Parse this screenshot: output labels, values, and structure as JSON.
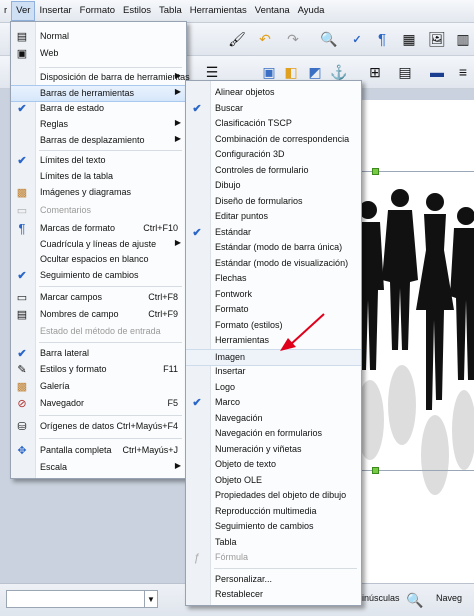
{
  "menubar": {
    "items": [
      {
        "label": "r"
      },
      {
        "label": "Ver"
      },
      {
        "label": "Insertar"
      },
      {
        "label": "Formato"
      },
      {
        "label": "Estilos"
      },
      {
        "label": "Tabla"
      },
      {
        "label": "Herramientas"
      },
      {
        "label": "Ventana"
      },
      {
        "label": "Ayuda"
      }
    ]
  },
  "view_menu": {
    "items": [
      {
        "label": "Normal"
      },
      {
        "label": "Web"
      },
      {
        "label": "Disposición de barra de herramientas"
      },
      {
        "label": "Barras de herramientas"
      },
      {
        "label": "Barra de estado"
      },
      {
        "label": "Reglas"
      },
      {
        "label": "Barras de desplazamiento"
      },
      {
        "label": "Límites del texto"
      },
      {
        "label": "Límites de la tabla"
      },
      {
        "label": "Imágenes y diagramas"
      },
      {
        "label": "Comentarios"
      },
      {
        "label": "Marcas de formato",
        "shortcut": "Ctrl+F10"
      },
      {
        "label": "Cuadrícula y líneas de ajuste"
      },
      {
        "label": "Ocultar espacios en blanco"
      },
      {
        "label": "Seguimiento de cambios"
      },
      {
        "label": "Marcar campos",
        "shortcut": "Ctrl+F8"
      },
      {
        "label": "Nombres de campo",
        "shortcut": "Ctrl+F9"
      },
      {
        "label": "Estado del método de entrada"
      },
      {
        "label": "Barra lateral"
      },
      {
        "label": "Estilos y formato",
        "shortcut": "F11"
      },
      {
        "label": "Galería"
      },
      {
        "label": "Navegador",
        "shortcut": "F5"
      },
      {
        "label": "Orígenes de datos",
        "shortcut": "Ctrl+Mayús+F4"
      },
      {
        "label": "Pantalla completa",
        "shortcut": "Ctrl+Mayús+J"
      },
      {
        "label": "Escala"
      }
    ]
  },
  "toolbars_menu": {
    "items": [
      {
        "label": "Alinear objetos"
      },
      {
        "label": "Buscar"
      },
      {
        "label": "Clasificación TSCP"
      },
      {
        "label": "Combinación de correspondencia"
      },
      {
        "label": "Configuración 3D"
      },
      {
        "label": "Controles de formulario"
      },
      {
        "label": "Dibujo"
      },
      {
        "label": "Diseño de formularios"
      },
      {
        "label": "Editar puntos"
      },
      {
        "label": "Estándar"
      },
      {
        "label": "Estándar (modo de barra única)"
      },
      {
        "label": "Estándar (modo de visualización)"
      },
      {
        "label": "Flechas"
      },
      {
        "label": "Fontwork"
      },
      {
        "label": "Formato"
      },
      {
        "label": "Formato (estilos)"
      },
      {
        "label": "Herramientas"
      },
      {
        "label": "Imagen"
      },
      {
        "label": "Insertar"
      },
      {
        "label": "Logo"
      },
      {
        "label": "Marco"
      },
      {
        "label": "Navegación"
      },
      {
        "label": "Navegación en formularios"
      },
      {
        "label": "Numeración y viñetas"
      },
      {
        "label": "Objeto de texto"
      },
      {
        "label": "Objeto OLE"
      },
      {
        "label": "Propiedades del objeto de dibujo"
      },
      {
        "label": "Reproducción multimedia"
      },
      {
        "label": "Seguimiento de cambios"
      },
      {
        "label": "Tabla"
      },
      {
        "label": "Fórmula"
      },
      {
        "label": "Personalizar..."
      },
      {
        "label": "Restablecer"
      }
    ]
  },
  "statusbar": {
    "case_label": "inúsculas",
    "right_label": "Naveg"
  },
  "colors": {
    "check": "#2a66c9",
    "highlight": "#d6e7fb",
    "annotation_arrow": "#e0001b"
  }
}
